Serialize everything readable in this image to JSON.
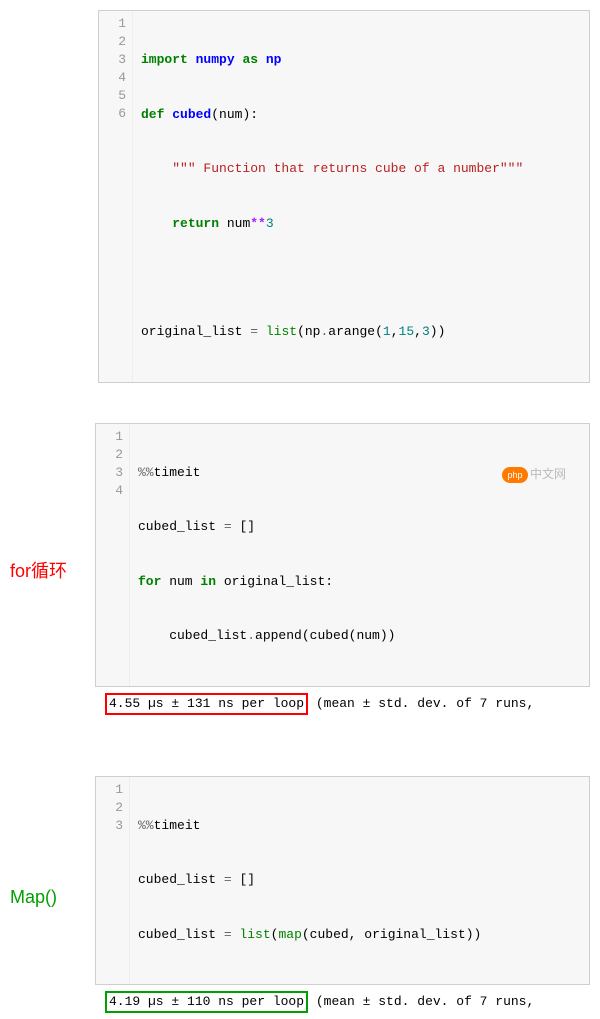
{
  "block1": {
    "lineNums": [
      "1",
      "2",
      "3",
      "4",
      "5",
      "6"
    ],
    "l1": {
      "import": "import",
      "numpy": "numpy",
      "as": "as",
      "np": "np"
    },
    "l2": {
      "def": "def",
      "name": "cubed",
      "params": "(num):"
    },
    "l3": {
      "doc": "\"\"\" Function that returns cube of a number\"\"\""
    },
    "l4": {
      "return": "return",
      "var": "num",
      "op": "**",
      "n": "3"
    },
    "l6": {
      "var": "original_list ",
      "eq": "=",
      "list": "list",
      "open": "(",
      "np": "np",
      "dot": ".",
      "arange": "arange(",
      "a": "1",
      "c1": ",",
      "b": "15",
      "c2": ",",
      "c": "3",
      "close": "))"
    }
  },
  "section_for": {
    "label": "for循环",
    "lineNums": [
      "1",
      "2",
      "3",
      "4"
    ],
    "l1": {
      "magic": "%%",
      "timeit": "timeit"
    },
    "l2": {
      "var": "cubed_list ",
      "eq": "=",
      "br": " []"
    },
    "l3": {
      "for": "for",
      "num": " num ",
      "in": "in",
      "rest": " original_list:"
    },
    "l4": {
      "body": "    cubed_list",
      "dot": ".",
      "append": "append(cubed(num))"
    },
    "out_hl": "4.55 µs ± 131 ns per loop",
    "out_rest": " (mean ± std. dev. of 7 runs,"
  },
  "section_map": {
    "label": "Map()",
    "lineNums": [
      "1",
      "2",
      "3"
    ],
    "l1": {
      "magic": "%%",
      "timeit": "timeit"
    },
    "l2": {
      "var": "cubed_list ",
      "eq": "=",
      "br": " []"
    },
    "l3": {
      "var": "cubed_list ",
      "eq": "=",
      "list": " list",
      "open": "(",
      "map": "map",
      "rest": "(cubed, original_list))"
    },
    "out_hl": "4.19 µs ± 110 ns per loop",
    "out_rest": " (mean ± std. dev. of 7 runs,"
  },
  "watermark": {
    "badge": "php",
    "text": "中文网"
  }
}
